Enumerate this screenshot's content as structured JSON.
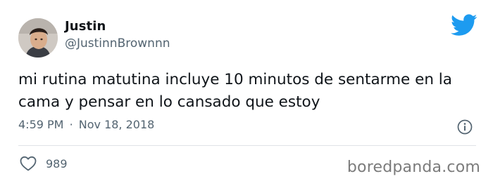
{
  "author": {
    "display_name": "Justin",
    "handle": "@JustinnBrownnn"
  },
  "tweet": {
    "text": "mi rutina matutina incluye 10 minutos de sentarme en la cama y pensar en lo cansado que estoy",
    "time": "4:59 PM",
    "separator": "·",
    "date": "Nov 18, 2018",
    "like_count": "989"
  },
  "watermark": "boredpanda.com",
  "icons": {
    "brand": "twitter-bird-icon",
    "info": "info-icon",
    "like": "heart-icon"
  },
  "colors": {
    "twitter_blue": "#1d9bf0",
    "secondary_text": "#536471",
    "primary_text": "#0f1419"
  }
}
